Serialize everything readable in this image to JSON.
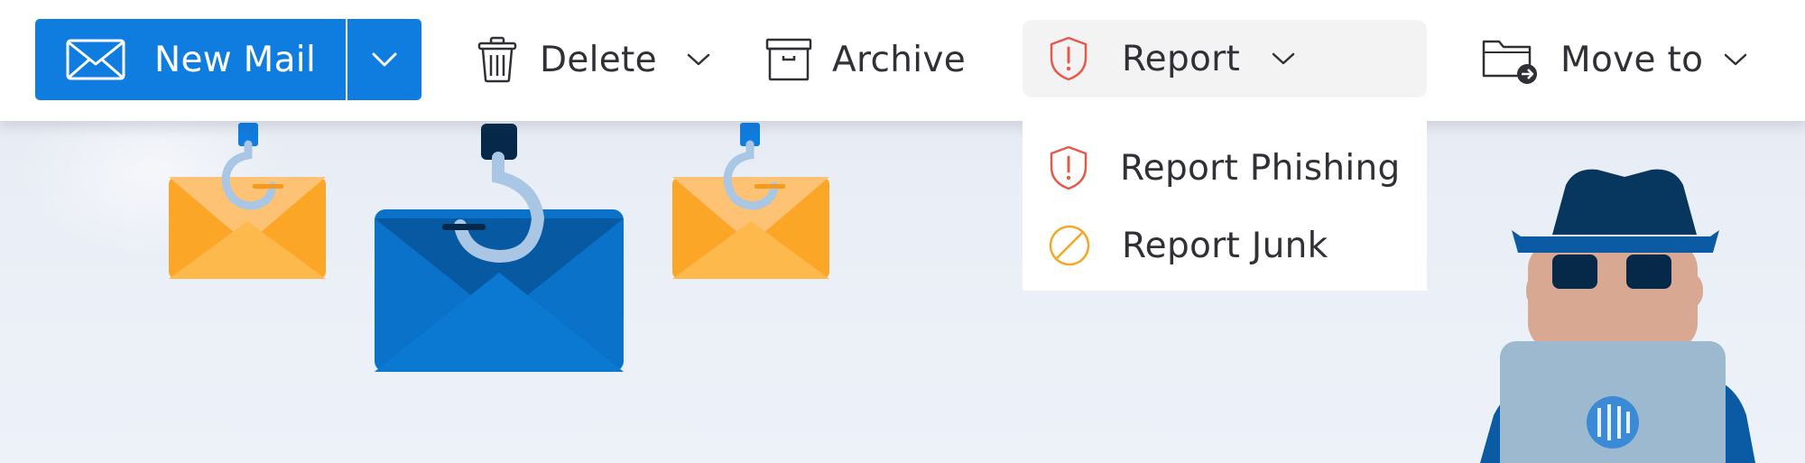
{
  "toolbar": {
    "new_mail": {
      "label": "New Mail",
      "icon": "envelope-icon",
      "dropdown_icon": "chevron-down-icon"
    },
    "delete": {
      "label": "Delete",
      "icon": "trash-icon",
      "dropdown_icon": "chevron-down-icon"
    },
    "archive": {
      "label": "Archive",
      "icon": "archive-box-icon"
    },
    "report": {
      "label": "Report",
      "icon": "shield-alert-icon",
      "dropdown_icon": "chevron-down-icon"
    },
    "move_to": {
      "label": "Move to",
      "icon": "folder-arrow-icon",
      "dropdown_icon": "chevron-down-icon"
    }
  },
  "report_menu": {
    "items": [
      {
        "label": "Report Phishing",
        "icon": "shield-alert-icon"
      },
      {
        "label": "Report Junk",
        "icon": "no-entry-icon"
      }
    ]
  },
  "colors": {
    "accent": "#0f7ddf",
    "report_red": "#e8584a",
    "junk_orange": "#f5a623",
    "envelope_orange": "#fba627",
    "envelope_blue": "#0a73c9",
    "hacker_navy": "#07375e"
  }
}
